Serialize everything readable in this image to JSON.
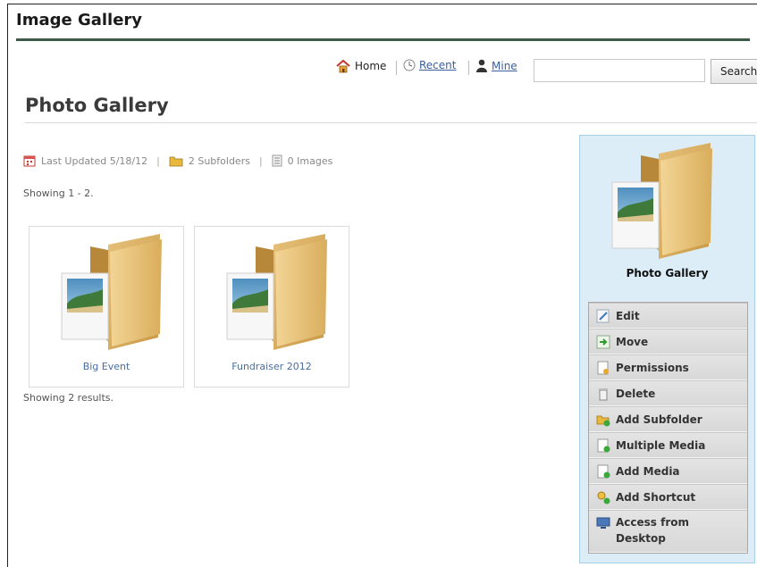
{
  "app": {
    "title": "Image Gallery"
  },
  "nav": {
    "home": "Home",
    "recent": "Recent",
    "mine": "Mine"
  },
  "search": {
    "button": "Search",
    "value": ""
  },
  "page": {
    "title": "Photo Gallery"
  },
  "meta": {
    "last_updated": "Last Updated 5/18/12",
    "subfolders": "2 Subfolders",
    "images": "0 Images"
  },
  "showing": "Showing 1 - 2.",
  "results": "Showing 2 results.",
  "tiles": [
    {
      "label": "Big Event"
    },
    {
      "label": "Fundraiser 2012"
    }
  ],
  "panel": {
    "title": "Photo Gallery",
    "menu": [
      {
        "label": "Edit",
        "icon": "edit-icon"
      },
      {
        "label": "Move",
        "icon": "move-icon"
      },
      {
        "label": "Permissions",
        "icon": "permissions-icon"
      },
      {
        "label": "Delete",
        "icon": "trash-icon"
      },
      {
        "label": "Add Subfolder",
        "icon": "add-folder-icon"
      },
      {
        "label": "Multiple Media",
        "icon": "multiple-media-icon"
      },
      {
        "label": "Add Media",
        "icon": "add-media-icon"
      },
      {
        "label": "Add Shortcut",
        "icon": "add-shortcut-icon"
      },
      {
        "label": "Access from Desktop",
        "icon": "desktop-icon"
      }
    ]
  }
}
